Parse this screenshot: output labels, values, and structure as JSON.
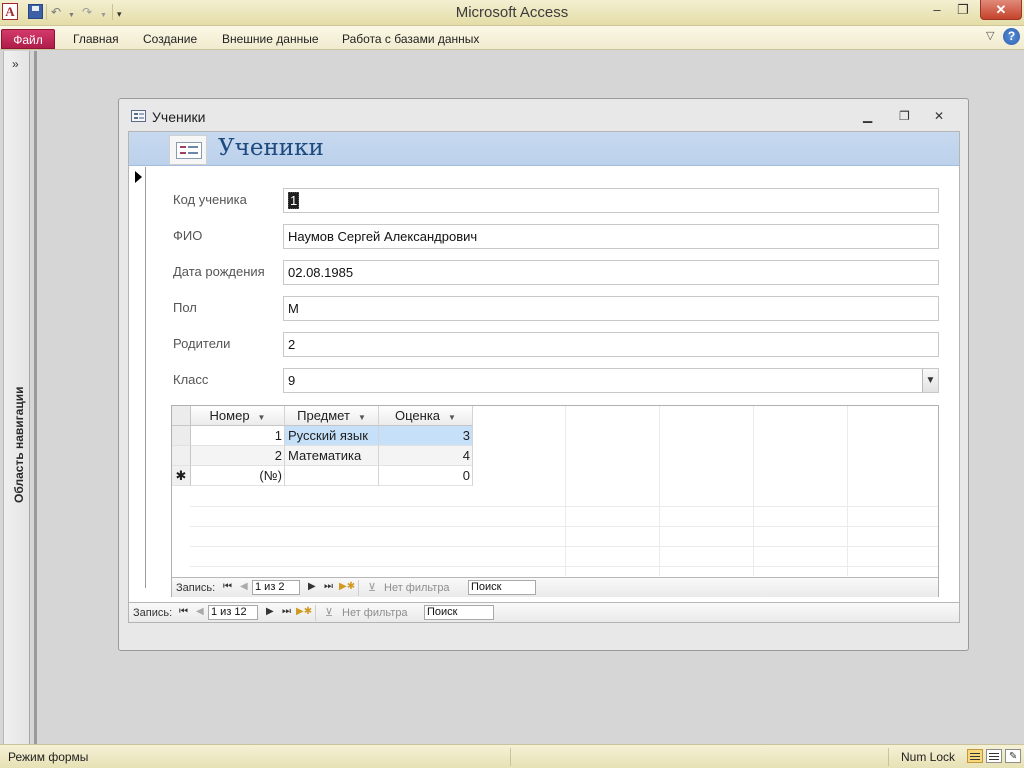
{
  "app": {
    "title": "Microsoft Access",
    "logo_letter": "A"
  },
  "quick_access": {
    "save_icon": "save-icon",
    "undo_icon": "undo-icon",
    "redo_icon": "redo-icon"
  },
  "ribbon": {
    "tabs": [
      "Файл",
      "Главная",
      "Создание",
      "Внешние данные",
      "Работа с базами данных"
    ]
  },
  "nav_pane": {
    "toggle": "»",
    "label": "Область навигации"
  },
  "form_window": {
    "title": "Ученики",
    "header_title": "Ученики"
  },
  "fields": [
    {
      "label": "Код ученика",
      "value": "1"
    },
    {
      "label": "ФИО",
      "value": "Наумов Сергей Александрович"
    },
    {
      "label": "Дата рождения",
      "value": "02.08.1985"
    },
    {
      "label": "Пол",
      "value": "М"
    },
    {
      "label": "Родители",
      "value": "2"
    },
    {
      "label": "Класс",
      "value": "9"
    }
  ],
  "subform": {
    "columns": [
      "Номер",
      "Предмет",
      "Оценка"
    ],
    "rows": [
      {
        "num": "1",
        "subject": "Русский язык",
        "grade": "3"
      },
      {
        "num": "2",
        "subject": "Математика",
        "grade": "4"
      }
    ],
    "new_row": {
      "marker": "✱",
      "num": "(№)",
      "subject": "",
      "grade": "0"
    },
    "nav": {
      "label": "Запись:",
      "position": "1 из 2",
      "filter": "Нет фильтра",
      "search": "Поиск"
    }
  },
  "main_nav": {
    "label": "Запись:",
    "position": "1 из 12",
    "filter": "Нет фильтра",
    "search": "Поиск"
  },
  "statusbar": {
    "mode": "Режим формы",
    "numlock": "Num Lock"
  },
  "colors": {
    "file_tab": "#b01d4a",
    "form_header": "#c7d9ef",
    "header_title": "#1f4a7e",
    "selection": "#c5e0f8"
  }
}
